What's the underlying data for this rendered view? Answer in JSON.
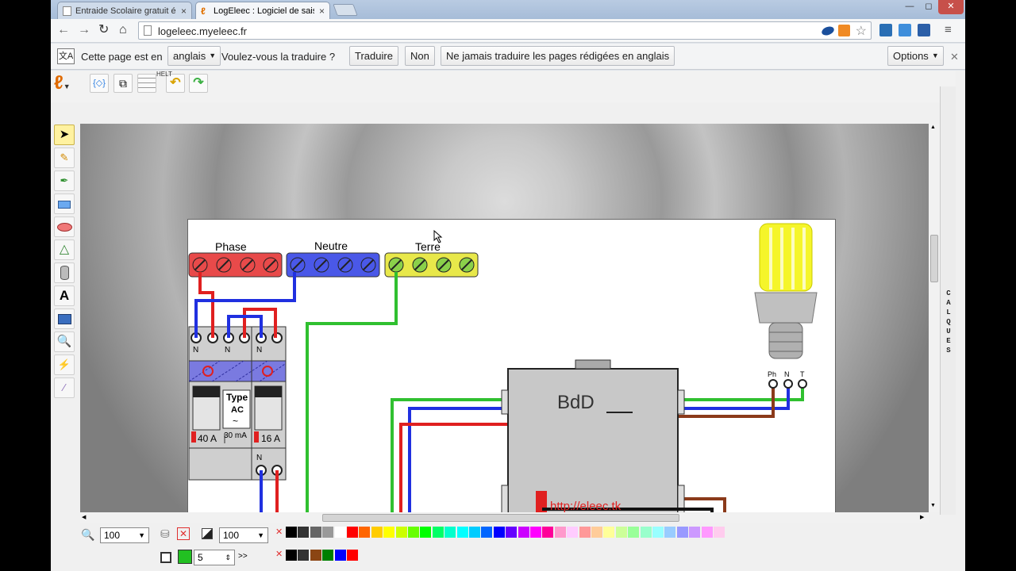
{
  "tabs": [
    {
      "title": "Entraide Scolaire gratuit él",
      "close": "×"
    },
    {
      "title": "LogEleec : Logiciel de saisi",
      "close": "×"
    }
  ],
  "window_controls": {
    "minimize": "—",
    "maximize": "◻",
    "close": "✕"
  },
  "address": {
    "url": "logeleec.myeleec.fr"
  },
  "translate_bar": {
    "prefix": "Cette page est en",
    "language": "anglais",
    "question": "Voulez-vous la traduire ?",
    "translate": "Traduire",
    "no": "Non",
    "never": "Ne jamais traduire les pages rédigées en anglais",
    "options": "Options",
    "close": "✕"
  },
  "app_toolbar": {
    "tooltip_hint": "HELT"
  },
  "diagram": {
    "phase_label": "Phase",
    "neutre_label": "Neutre",
    "terre_label": "Terre",
    "breaker_n1": "N",
    "breaker_n2": "N",
    "breaker_n3": "N",
    "breaker_n4": "N",
    "diff_type": "Type",
    "diff_ac": "AC",
    "diff_tilde": "~",
    "rating_40": "40 A",
    "rating_30ma": "30 mA",
    "rating_16": "16 A",
    "box_label": "BdD",
    "url_text": "http://eleec.tk",
    "lamp_ph": "Ph",
    "lamp_n": "N",
    "lamp_t": "T"
  },
  "calques_label": [
    "C",
    "A",
    "L",
    "Q",
    "U",
    "E",
    "S"
  ],
  "bottom_bar": {
    "zoom": "100",
    "opacity": "100",
    "line_width": "5",
    "more": ">>"
  },
  "palette_row1": [
    "#000000",
    "#333333",
    "#666666",
    "#999999",
    "#ffffff",
    "#ff0000",
    "#ff6600",
    "#ffcc00",
    "#ffff00",
    "#ccff00",
    "#66ff00",
    "#00ff00",
    "#00ff66",
    "#00ffcc",
    "#00ffff",
    "#00ccff",
    "#0066ff",
    "#0000ff",
    "#6600ff",
    "#cc00ff",
    "#ff00ff",
    "#ff0099",
    "#ff99cc",
    "#ffccff",
    "#ff9999",
    "#ffcc99",
    "#ffff99",
    "#ccff99",
    "#99ff99",
    "#99ffcc",
    "#99ffff",
    "#99ccff",
    "#9999ff",
    "#cc99ff",
    "#ff99ff",
    "#ffccee"
  ],
  "palette_row2": [
    "#000000",
    "#333333",
    "#8b4513",
    "#008000",
    "#0000ff",
    "#ff0000"
  ]
}
